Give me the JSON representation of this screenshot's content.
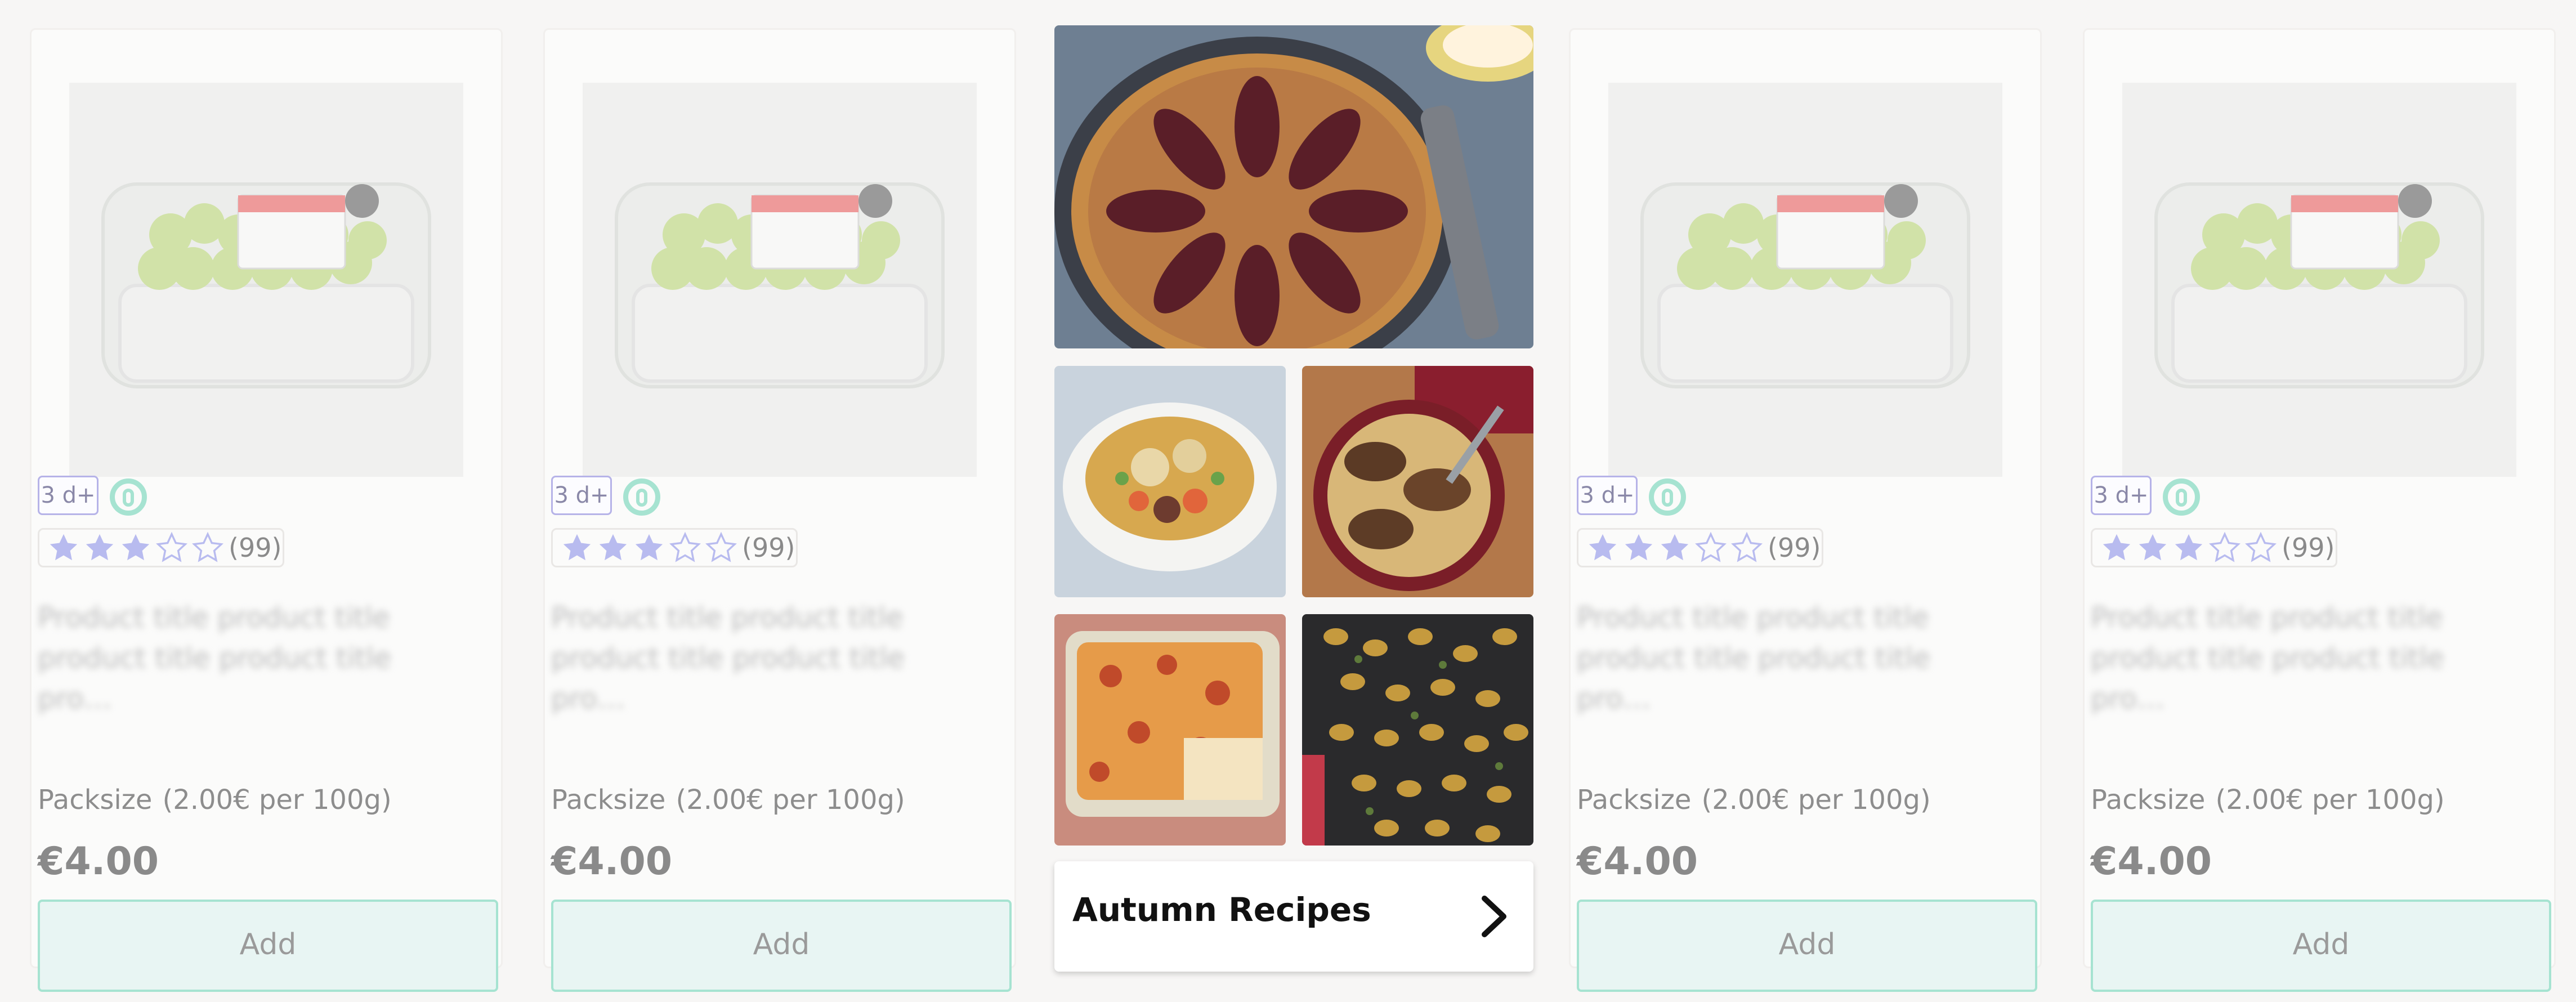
{
  "products": [
    {
      "badge_days": "3 d+",
      "rating_count": "(99)",
      "stars_filled": 3,
      "stars_total": 5,
      "title": "Product title product title product title product title pro…",
      "packsize": "Packsize",
      "unit_price": "(2.00€ per 100g)",
      "price": "€4.00",
      "add_label": "Add"
    },
    {
      "badge_days": "3 d+",
      "rating_count": "(99)",
      "stars_filled": 3,
      "stars_total": 5,
      "title": "Product title product title product title product title pro…",
      "packsize": "Packsize",
      "unit_price": "(2.00€ per 100g)",
      "price": "€4.00",
      "add_label": "Add"
    },
    {
      "badge_days": "3 d+",
      "rating_count": "(99)",
      "stars_filled": 3,
      "stars_total": 5,
      "title": "Product title product title product title product title pro…",
      "packsize": "Packsize",
      "unit_price": "(2.00€ per 100g)",
      "price": "€4.00",
      "add_label": "Add"
    },
    {
      "badge_days": "3 d+",
      "rating_count": "(99)",
      "stars_filled": 3,
      "stars_total": 5,
      "title": "Product title product title product title product title pro…",
      "packsize": "Packsize",
      "unit_price": "(2.00€ per 100g)",
      "price": "€4.00",
      "add_label": "Add"
    }
  ],
  "recipe": {
    "label": "Autumn Recipes",
    "icon": "chevron-right-icon"
  },
  "colors": {
    "badge_border": "#b6b3e8",
    "organic_green": "#a6e3d1",
    "star_fill": "#b8bbef",
    "button_bg": "#e8f5f3"
  }
}
